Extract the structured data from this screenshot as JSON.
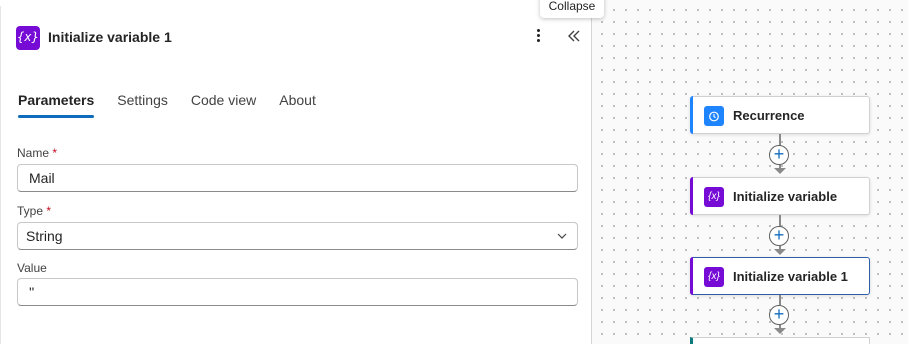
{
  "tooltip": "Collapse",
  "panel": {
    "icon_glyph": "{x}",
    "title": "Initialize variable 1",
    "tabs": [
      {
        "label": "Parameters",
        "active": true
      },
      {
        "label": "Settings",
        "active": false
      },
      {
        "label": "Code view",
        "active": false
      },
      {
        "label": "About",
        "active": false
      }
    ],
    "fields": {
      "name": {
        "label": "Name",
        "required_mark": "*",
        "value": "Mail"
      },
      "type": {
        "label": "Type",
        "required_mark": "*",
        "value": "String"
      },
      "value": {
        "label": "Value",
        "value": "''"
      }
    }
  },
  "flow": {
    "nodes": [
      {
        "label": "Recurrence",
        "icon": "clock-icon",
        "color": "#1f85ff"
      },
      {
        "label": "Initialize variable",
        "icon_glyph": "{x}",
        "color": "#770bd6"
      },
      {
        "label": "Initialize variable 1",
        "icon_glyph": "{x}",
        "color": "#770bd6",
        "selected": true
      }
    ]
  },
  "colors": {
    "accent": "#0f6cbd",
    "variable": "#770bd6",
    "recurrence": "#1f85ff",
    "required": "#c50f1f"
  }
}
